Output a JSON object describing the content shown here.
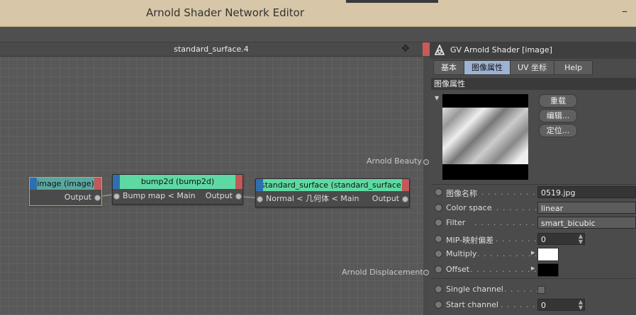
{
  "window": {
    "title": "Arnold Shader Network Editor",
    "minimize": "–"
  },
  "graph": {
    "header": "standard_surface.4",
    "nodes": {
      "image": {
        "title": "image (image)",
        "output": "Output"
      },
      "bump2d": {
        "title": "bump2d (bump2d)",
        "input": "Bump map < Main",
        "output": "Output"
      },
      "standard_surface": {
        "title": "standard_surface (standard_surface)",
        "input": "Normal < 几何体 < Main",
        "output": "Output"
      }
    },
    "labels": {
      "beauty": "Arnold Beauty",
      "displacement": "Arnold Displacement"
    },
    "colors": {
      "node_head_green": "#5fd9a3",
      "node_head_image": "#5aa7a0",
      "port_left": "#2f6fb0",
      "port_right": "#c35858"
    }
  },
  "panel": {
    "title": "GV Arnold Shader [image]",
    "tabs": [
      "基本",
      "图像属性",
      "UV 坐标",
      "Help"
    ],
    "active_tab": "图像属性",
    "section": "图像属性",
    "buttons": {
      "reload": "重载",
      "edit": "编辑...",
      "locate": "定位..."
    },
    "props": {
      "filename": {
        "label": "图像名称",
        "dots": ". . . . . . . . . . . . .",
        "value": "0519.jpg"
      },
      "color_space": {
        "label": "Color space",
        "dots": ". . . . . . . .",
        "value": "linear"
      },
      "filter": {
        "label": "Filter",
        "dots": ". . . . . . . . . . . . . . .",
        "value": "smart_bicubic"
      },
      "mip": {
        "label": "MIP-映射偏差",
        "dots": ". . . . . . .",
        "value": "0"
      },
      "multiply": {
        "label": "Multiply",
        "dots": ". . . . . . . . . . . .",
        "color": "#ffffff"
      },
      "offset": {
        "label": "Offset",
        "dots": ". . . . . . . . . . . . . .",
        "color": "#000000"
      },
      "single_channel": {
        "label": "Single channel",
        "dots": ". . . . . . ."
      },
      "start_channel": {
        "label": "Start channel",
        "dots": ". . . . . . .",
        "value": "0"
      }
    }
  }
}
